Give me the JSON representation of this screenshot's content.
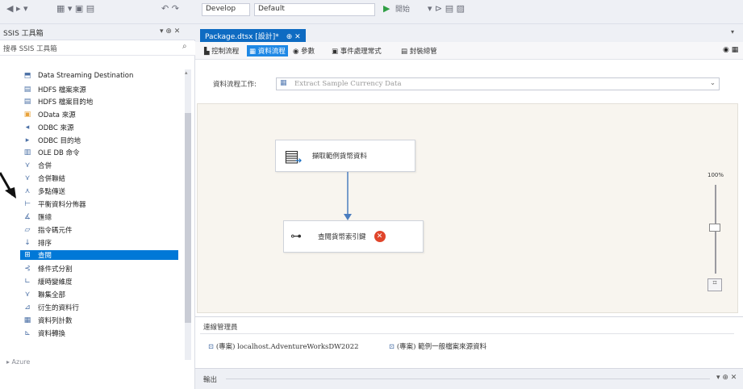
{
  "toolbar": {
    "solution_config": "Develop",
    "platform": "Default",
    "start_label": "開始"
  },
  "left_panel": {
    "title": "SSIS 工具箱",
    "pin_glyph": "▾ ⊕ ✕",
    "search_placeholder": "搜尋 SSIS 工具箱",
    "items": [
      {
        "label": "Data Streaming Destination",
        "icon": "data-streaming-icon"
      },
      {
        "label": "HDFS 檔案來源",
        "icon": "hdfs-source-icon"
      },
      {
        "label": "HDFS 檔案目的地",
        "icon": "hdfs-dest-icon"
      },
      {
        "label": "OData 來源",
        "icon": "odata-icon"
      },
      {
        "label": "ODBC 來源",
        "icon": "odbc-source-icon"
      },
      {
        "label": "ODBC 目的地",
        "icon": "odbc-dest-icon"
      },
      {
        "label": "OLE DB 命令",
        "icon": "oledb-command-icon"
      },
      {
        "label": "合併",
        "icon": "merge-icon"
      },
      {
        "label": "合併聯結",
        "icon": "merge-join-icon"
      },
      {
        "label": "多點傳送",
        "icon": "multicast-icon"
      },
      {
        "label": "平衡資料分佈器",
        "icon": "balanced-distributor-icon"
      },
      {
        "label": "匯總",
        "icon": "aggregate-icon"
      },
      {
        "label": "指令碼元件",
        "icon": "script-component-icon"
      },
      {
        "label": "排序",
        "icon": "sort-icon"
      },
      {
        "label": "查閱",
        "icon": "lookup-icon",
        "selected": true
      },
      {
        "label": "條件式分割",
        "icon": "conditional-split-icon"
      },
      {
        "label": "緩時變維度",
        "icon": "scd-icon"
      },
      {
        "label": "聯集全部",
        "icon": "union-all-icon"
      },
      {
        "label": "衍生的資料行",
        "icon": "derived-column-icon"
      },
      {
        "label": "資料列計數",
        "icon": "row-count-icon"
      },
      {
        "label": "資料轉換",
        "icon": "data-conversion-icon"
      }
    ],
    "footer": "▸ Azure"
  },
  "document": {
    "tab_label": "Package.dtsx [設計]*",
    "tab_pin": "⊕ ✕",
    "sub_tabs": [
      {
        "label": "控制流程",
        "active": false
      },
      {
        "label": "資料流程",
        "active": true
      },
      {
        "label": "參數",
        "active": false
      },
      {
        "label": "事件處理常式",
        "active": false
      },
      {
        "label": "封裝總管",
        "active": false
      }
    ],
    "dft_label": "資料流程工作:",
    "dft_value": "Extract Sample Currency Data"
  },
  "canvas": {
    "nodes": [
      {
        "label": "擷取範例貨幣資料",
        "icon": "flat-file-source-icon",
        "error": false
      },
      {
        "label": "查閱貨幣索引鍵",
        "icon": "lookup-icon",
        "error": true
      }
    ],
    "zoom_label": "100%"
  },
  "connection_managers": {
    "tab_label": "連線管理員",
    "items": [
      "(專案) localhost.AdventureWorksDW2022",
      "(專案) 範例一般檔案來源資料"
    ]
  },
  "output": {
    "label": "輸出"
  },
  "colors": {
    "accent": "#0078d7",
    "canvas": "#f8f5ef",
    "error": "#e0452b"
  }
}
